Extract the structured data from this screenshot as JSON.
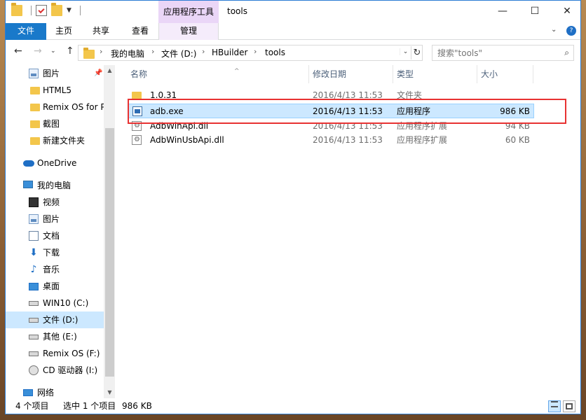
{
  "window": {
    "title": "tools",
    "context_tab_header": "应用程序工具",
    "controls": {
      "minimize": "—",
      "maximize": "☐",
      "close": "✕"
    }
  },
  "ribbon": {
    "tabs": {
      "file": "文件",
      "home": "主页",
      "share": "共享",
      "view": "查看",
      "manage": "管理"
    },
    "collapse": "⌄",
    "help": "?"
  },
  "nav": {
    "back": "←",
    "forward": "→",
    "recent": "⌄",
    "up": "↑",
    "breadcrumb": [
      "我的电脑",
      "文件 (D:)",
      "HBuilder",
      "tools"
    ],
    "separator": "›",
    "address_dropdown": "⌄",
    "refresh": "↻",
    "search_placeholder": "搜索\"tools\"",
    "search_icon": "⌕"
  },
  "sidebar": {
    "pin": "📌",
    "items": [
      {
        "label": "图片",
        "icon": "pictures-icon"
      },
      {
        "label": "HTML5",
        "icon": "folder-icon"
      },
      {
        "label": "Remix OS for P",
        "icon": "folder-icon"
      },
      {
        "label": "截图",
        "icon": "folder-icon"
      },
      {
        "label": "新建文件夹",
        "icon": "folder-icon"
      },
      {
        "label": "OneDrive",
        "icon": "onedrive-icon"
      },
      {
        "label": "我的电脑",
        "icon": "computer-icon"
      },
      {
        "label": "视频",
        "icon": "video-icon"
      },
      {
        "label": "图片",
        "icon": "pictures-icon"
      },
      {
        "label": "文档",
        "icon": "documents-icon"
      },
      {
        "label": "下载",
        "icon": "download-icon"
      },
      {
        "label": "音乐",
        "icon": "music-icon"
      },
      {
        "label": "桌面",
        "icon": "desktop-icon"
      },
      {
        "label": "WIN10 (C:)",
        "icon": "system-drive-icon"
      },
      {
        "label": "文件 (D:)",
        "icon": "drive-icon"
      },
      {
        "label": "其他 (E:)",
        "icon": "drive-icon"
      },
      {
        "label": "Remix OS (F:)",
        "icon": "drive-icon"
      },
      {
        "label": "CD 驱动器 (I:)",
        "icon": "cd-drive-icon"
      },
      {
        "label": "网络",
        "icon": "network-icon"
      }
    ],
    "scroll_up": "▲",
    "scroll_down": "▼"
  },
  "list": {
    "columns": {
      "name": "名称",
      "date": "修改日期",
      "type": "类型",
      "size": "大小"
    },
    "sort_indicator": "^",
    "rows": [
      {
        "name": "1.0.31",
        "date": "2016/4/13 11:53",
        "type": "文件夹",
        "size": "",
        "icon": "folder-icon"
      },
      {
        "name": "adb.exe",
        "date": "2016/4/13 11:53",
        "type": "应用程序",
        "size": "986 KB",
        "icon": "exe-icon"
      },
      {
        "name": "AdbWinApi.dll",
        "date": "2016/4/13 11:53",
        "type": "应用程序扩展",
        "size": "94 KB",
        "icon": "dll-icon"
      },
      {
        "name": "AdbWinUsbApi.dll",
        "date": "2016/4/13 11:53",
        "type": "应用程序扩展",
        "size": "60 KB",
        "icon": "dll-icon"
      }
    ]
  },
  "status": {
    "item_count": "4 个项目",
    "selection": "选中 1 个项目",
    "selection_size": "986 KB"
  },
  "colors": {
    "accent": "#1979ca",
    "selection": "#cce8ff",
    "context_tab": "#ead6f7",
    "highlight_box": "#e83232"
  }
}
